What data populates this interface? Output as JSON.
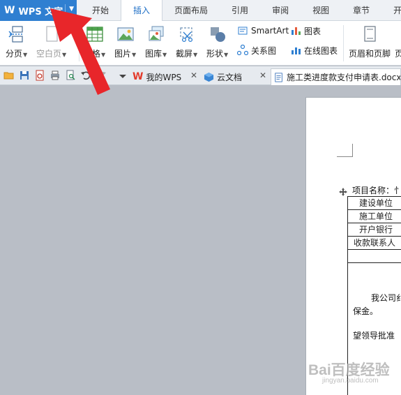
{
  "app": {
    "name": "WPS 文字",
    "logo": "W"
  },
  "menu_tabs": [
    {
      "label": "开始",
      "active": false
    },
    {
      "label": "插入",
      "active": true
    },
    {
      "label": "页面布局",
      "active": false
    },
    {
      "label": "引用",
      "active": false
    },
    {
      "label": "审阅",
      "active": false
    },
    {
      "label": "视图",
      "active": false
    },
    {
      "label": "章节",
      "active": false
    },
    {
      "label": "开",
      "active": false
    }
  ],
  "ribbon": {
    "page_break": "分页",
    "blank_page": "空白页",
    "table": "表格",
    "picture": "图片",
    "gallery": "图库",
    "screenshot": "截屏",
    "shapes": "形状",
    "smartart": "SmartArt",
    "chart": "图表",
    "relation": "关系图",
    "online_chart": "在线图表",
    "header_footer": "页眉和页脚",
    "page_num": "页"
  },
  "doc_tabs": {
    "my_wps": "我的WPS",
    "cloud": "云文档",
    "active_doc": "施工类进度款支付申请表.docx"
  },
  "document": {
    "project_label": "项目名称：",
    "project_value_hint": "忄",
    "rows": [
      "建设单位",
      "施工单位",
      "开户银行",
      "收款联系人"
    ],
    "para1": "我公司",
    "para1_hint": "纟",
    "para2": "保金。",
    "para3": "望领导批准"
  },
  "watermark": {
    "text": "Bai百度经验",
    "sub": "jingyan.baidu.com"
  },
  "colors": {
    "accent": "#2f7fd1",
    "arrow": "#e8262a",
    "active_tab": "#1e6fc6"
  }
}
